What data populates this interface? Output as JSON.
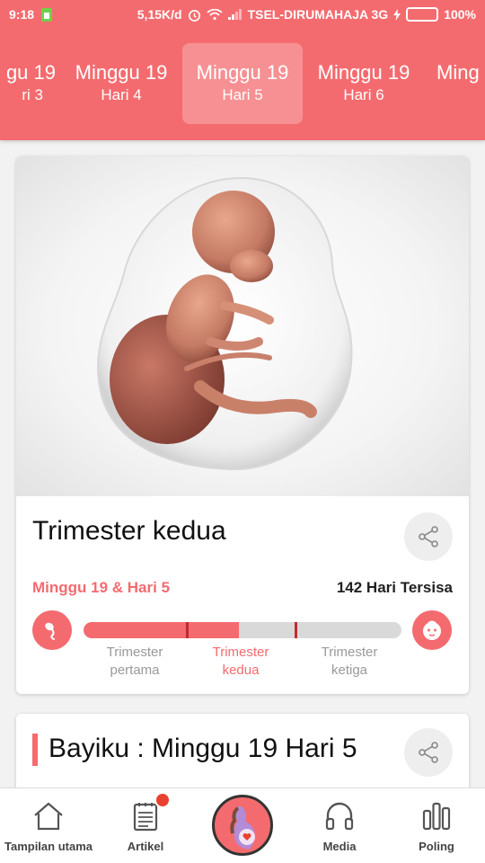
{
  "status_bar": {
    "time": "9:18",
    "speed": "5,15K/d",
    "carrier": "TSEL-DIRUMAHAJA 3G",
    "battery": "100%",
    "battery_level": 1.0,
    "icons": [
      "sim-icon",
      "alarm-icon",
      "wifi-icon",
      "signal-icon",
      "charging-icon",
      "battery-icon"
    ]
  },
  "day_tabs": [
    {
      "week": "gu 19",
      "day": "ri 3"
    },
    {
      "week": "Minggu 19",
      "day": "Hari 4"
    },
    {
      "week": "Minggu 19",
      "day": "Hari 5",
      "active": true
    },
    {
      "week": "Minggu 19",
      "day": "Hari 6"
    },
    {
      "week": "Ming",
      "day": ""
    }
  ],
  "card": {
    "image_alt": "fetus-illustration",
    "trimester_title": "Trimester kedua",
    "week_day_label": "Minggu 19 & Hari 5",
    "remaining": "142 Hari Tersisa",
    "progress": 0.49,
    "trimester_labels": [
      {
        "line1": "Trimester",
        "line2": "pertama"
      },
      {
        "line1": "Trimester",
        "line2": "kedua",
        "active": true
      },
      {
        "line1": "Trimester",
        "line2": "ketiga"
      }
    ]
  },
  "card2": {
    "title": "Bayiku : Minggu 19 Hari 5"
  },
  "bottom_nav": [
    {
      "label": "Tampilan utama",
      "icon": "home-icon"
    },
    {
      "label": "Artikel",
      "icon": "article-icon",
      "badge": true
    },
    {
      "label": "",
      "icon": "pregnancy-icon"
    },
    {
      "label": "Media",
      "icon": "headphones-icon"
    },
    {
      "label": "Poling",
      "icon": "poll-icon"
    }
  ],
  "colors": {
    "accent": "#f46b6f",
    "accent_dark": "#c22a2f",
    "track": "#d9d9d9"
  }
}
